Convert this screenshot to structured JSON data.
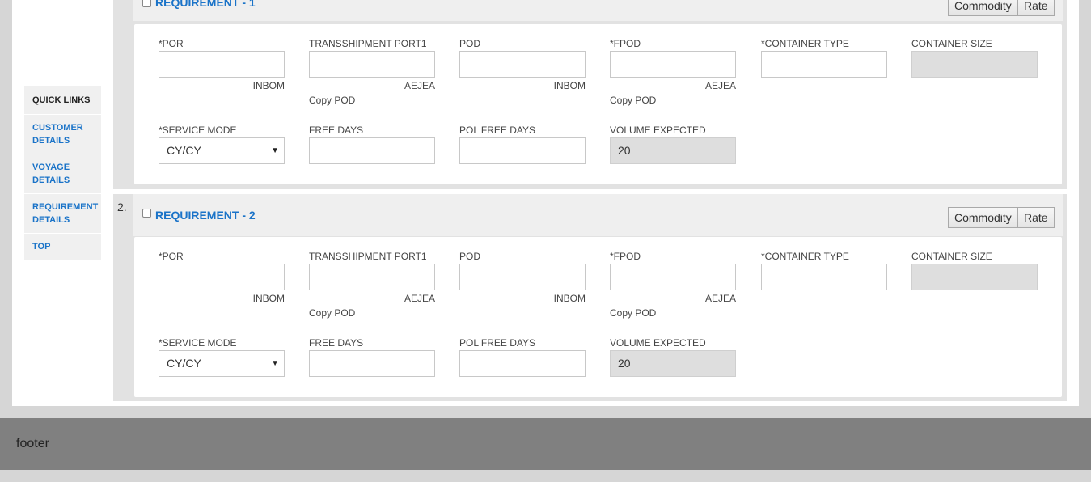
{
  "quick_links": {
    "header": "QUICK LINKS",
    "items": [
      "CUSTOMER DETAILS",
      "VOYAGE DETAILS",
      "REQUIREMENT DETAILS",
      "TOP"
    ]
  },
  "requirements": [
    {
      "number": "",
      "title": "REQUIREMENT - 1",
      "commodity_label": "Commodity",
      "rate_label": "Rate",
      "labels": {
        "por": "*POR",
        "transshipment": "TRANSSHIPMENT PORT1",
        "pod": "POD",
        "fpod": "*FPOD",
        "container_type": "*CONTAINER TYPE",
        "container_size": "CONTAINER SIZE",
        "service_mode": "*SERVICE MODE",
        "free_days": "FREE DAYS",
        "pol_free_days": "POL FREE DAYS",
        "volume_expected": "VOLUME EXPECTED"
      },
      "codes": {
        "por": "INBOM",
        "transshipment": "AEJEA",
        "pod": "INBOM",
        "fpod": "AEJEA"
      },
      "copy_pod_1": "Copy POD",
      "copy_pod_2": "Copy POD",
      "service_mode_value": "CY/CY",
      "volume_expected_value": "20"
    },
    {
      "number": "2.",
      "title": "REQUIREMENT - 2",
      "commodity_label": "Commodity",
      "rate_label": "Rate",
      "labels": {
        "por": "*POR",
        "transshipment": "TRANSSHIPMENT PORT1",
        "pod": "POD",
        "fpod": "*FPOD",
        "container_type": "*CONTAINER TYPE",
        "container_size": "CONTAINER SIZE",
        "service_mode": "*SERVICE MODE",
        "free_days": "FREE DAYS",
        "pol_free_days": "POL FREE DAYS",
        "volume_expected": "VOLUME EXPECTED"
      },
      "codes": {
        "por": "INBOM",
        "transshipment": "AEJEA",
        "pod": "INBOM",
        "fpod": "AEJEA"
      },
      "copy_pod_1": "Copy POD",
      "copy_pod_2": "Copy POD",
      "service_mode_value": "CY/CY",
      "volume_expected_value": "20"
    }
  ],
  "footer": {
    "text": "footer"
  }
}
